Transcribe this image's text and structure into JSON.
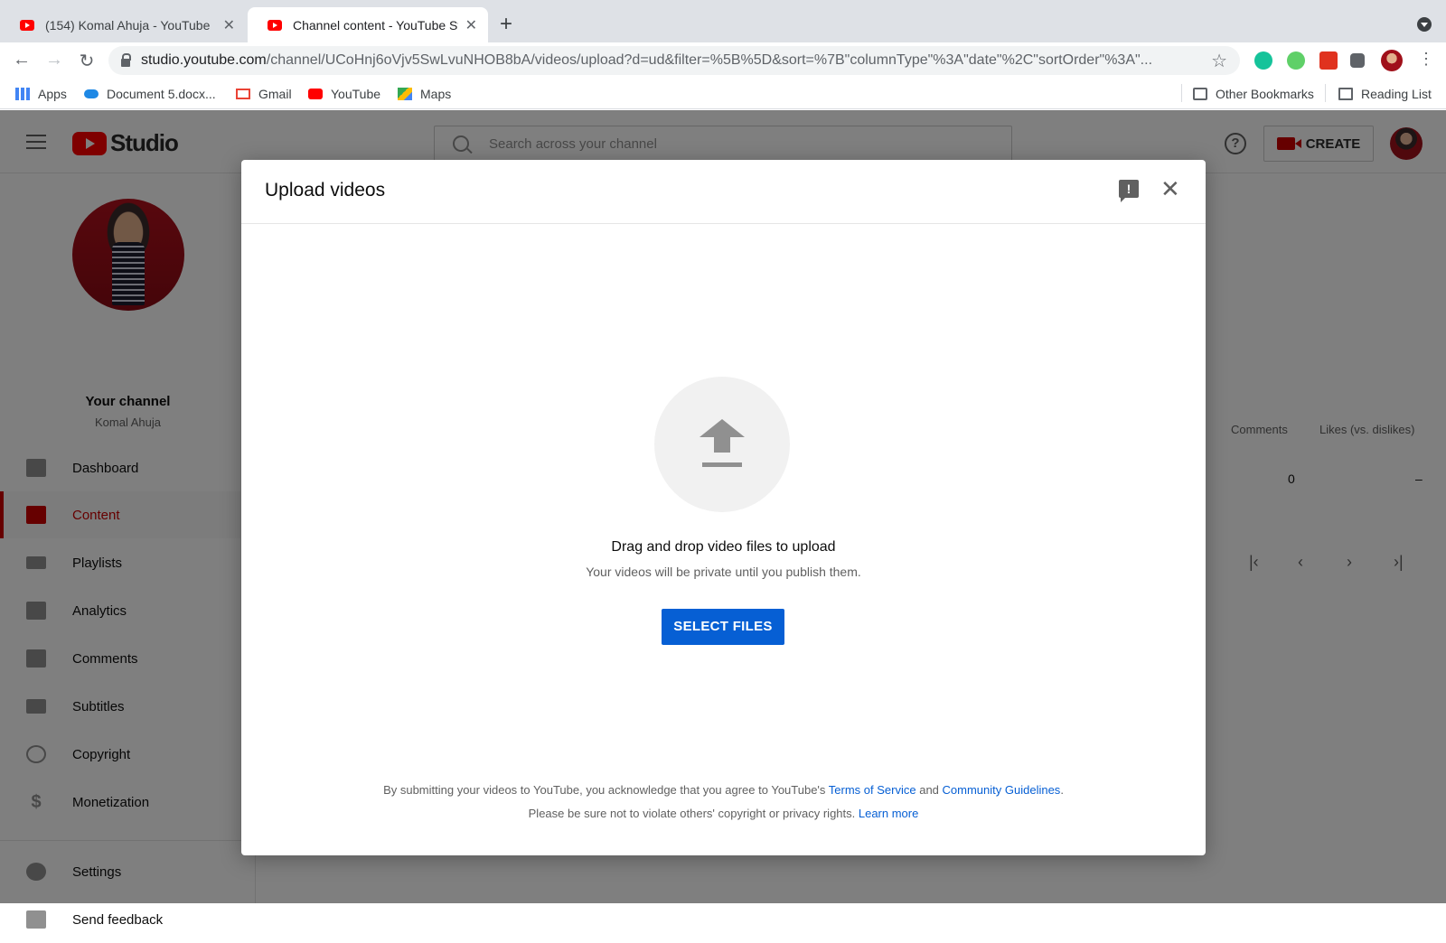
{
  "browser": {
    "tabs": [
      {
        "title": "(154) Komal Ahuja - YouTube"
      },
      {
        "title": "Channel content - YouTube Stu"
      }
    ],
    "new_tab": "+",
    "url_host": "studio.youtube.com",
    "url_path": "/channel/UCoHnj6oVjv5SwLvuNHOB8bA/videos/upload?d=ud&filter=%5B%5D&sort=%7B\"columnType\"%3A\"date\"%2C\"sortOrder\"%3A\"...",
    "bookmarks": [
      {
        "label": "Apps"
      },
      {
        "label": "Document 5.docx..."
      },
      {
        "label": "Gmail"
      },
      {
        "label": "YouTube"
      },
      {
        "label": "Maps"
      }
    ],
    "other_bookmarks": "Other Bookmarks",
    "reading_list": "Reading List"
  },
  "studio": {
    "logo_text": "Studio",
    "search_placeholder": "Search across your channel",
    "help": "?",
    "create_label": "CREATE",
    "channel": {
      "title": "Your channel",
      "name": "Komal Ahuja"
    },
    "nav": [
      {
        "label": "Dashboard"
      },
      {
        "label": "Content"
      },
      {
        "label": "Playlists"
      },
      {
        "label": "Analytics"
      },
      {
        "label": "Comments"
      },
      {
        "label": "Subtitles"
      },
      {
        "label": "Copyright"
      },
      {
        "label": "Monetization"
      }
    ],
    "bottom_nav": [
      {
        "label": "Settings"
      },
      {
        "label": "Send feedback"
      }
    ],
    "table": {
      "headers": [
        "Comments",
        "Likes (vs. dislikes)"
      ],
      "row": [
        "0",
        "–"
      ]
    }
  },
  "dialog": {
    "title": "Upload videos",
    "feedback_glyph": "!",
    "close_glyph": "✕",
    "drag_text": "Drag and drop video files to upload",
    "private_text": "Your videos will be private until you publish them.",
    "select_label": "SELECT FILES",
    "legal1_prefix": "By submitting your videos to YouTube, you acknowledge that you agree to YouTube's ",
    "terms_link": "Terms of Service",
    "legal1_and": " and ",
    "guidelines_link": "Community Guidelines",
    "legal1_suffix": ".",
    "legal2_prefix": "Please be sure not to violate others' copyright or privacy rights. ",
    "learn_more": "Learn more"
  },
  "colors": {
    "accent_blue": "#065fd4",
    "youtube_red": "#ff0000",
    "active_red": "#cc0000"
  }
}
